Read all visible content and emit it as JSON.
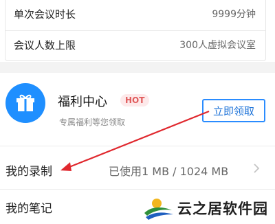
{
  "settings": {
    "single_meeting_duration": {
      "label": "单次会议时长",
      "value": "9999分钟"
    },
    "meeting_capacity": {
      "label": "会议人数上限",
      "value": "300人虚拟会议室"
    }
  },
  "welfare": {
    "title": "福利中心",
    "badge": "HOT",
    "subtitle": "专属福利等您领取",
    "claim_button": "立即领取",
    "icon": "gift-icon"
  },
  "list": {
    "recording": {
      "label": "我的录制",
      "value": "已使用1 MB / 1024 MB"
    },
    "notes": {
      "label": "我的笔记"
    }
  },
  "watermark": {
    "text": "云之居软件园"
  },
  "colors": {
    "accent": "#2a8cff",
    "hot": "#e05b5b",
    "annotation": "#e0282e"
  }
}
